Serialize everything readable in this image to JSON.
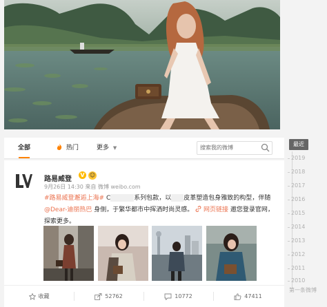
{
  "tabs": [
    {
      "label": "全部",
      "icon": ""
    },
    {
      "label": "热门",
      "icon": "flame-icon"
    },
    {
      "label": "更多",
      "icon": "chevron-down-icon"
    }
  ],
  "search": {
    "placeholder": "搜索我的微博"
  },
  "timeline": {
    "latest": "最近",
    "years": [
      "2019",
      "2018",
      "2017",
      "2016",
      "2015",
      "2014",
      "2013",
      "2012",
      "2011",
      "2010"
    ],
    "first": "第一条微博"
  },
  "post": {
    "username": "路易威登",
    "verified_badge": "V",
    "meta": "9月26日 14:30 来自 微博 weibo.com",
    "hashtag": "#路易威登邂逅上海#",
    "text_1": " C",
    "text_2": "系列包款，以",
    "text_3": "皮革塑造包身雅致的构型，伴随",
    "mention": "@Dear-迪丽热巴",
    "text_4": " 身侧，于繁华都市中挥洒时尚灵感。",
    "weblink": "网页链接",
    "text_5": " 邀您登录官网，探索更多。"
  },
  "actions": [
    {
      "label": "收藏",
      "icon": "star-icon"
    },
    {
      "label": "52762",
      "icon": "share-icon"
    },
    {
      "label": "10772",
      "icon": "comment-icon"
    },
    {
      "label": "47411",
      "icon": "like-icon"
    }
  ],
  "colors": {
    "accent": "#ff8200",
    "link": "#eb7350",
    "verified": "#ffba00"
  }
}
